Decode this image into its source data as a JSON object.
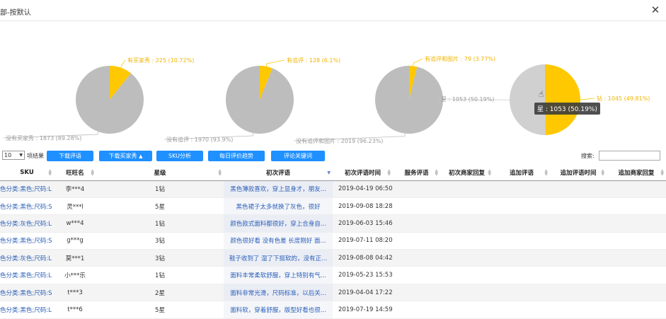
{
  "window": {
    "title": "部-按默认",
    "close_icon": "close-icon"
  },
  "chart_data": [
    {
      "type": "pie",
      "slices": [
        {
          "name": "有买家秀",
          "value": 225,
          "label": "有买家秀 : 225 (10.72%)",
          "color": "#ffc800"
        },
        {
          "name": "没有买家秀",
          "value": 1873,
          "label": "没有买家秀 : 1873 (89.28%)",
          "color": "#bdbdbd"
        }
      ]
    },
    {
      "type": "pie",
      "slices": [
        {
          "name": "有追评",
          "value": 128,
          "label": "有追评 : 128 (6.1%)",
          "color": "#ffc800"
        },
        {
          "name": "没有追评",
          "value": 1970,
          "label": "没有追评 : 1970 (93.9%)",
          "color": "#bdbdbd"
        }
      ]
    },
    {
      "type": "pie",
      "slices": [
        {
          "name": "有追评和图片",
          "value": 79,
          "label": "有追评和图片 : 79 (3.77%)",
          "color": "#ffc800"
        },
        {
          "name": "没有追评和图片",
          "value": 2019,
          "label": "没有追评和图片 : 2019 (96.23%)",
          "color": "#bdbdbd"
        }
      ]
    },
    {
      "type": "pie",
      "slices": [
        {
          "name": "钻",
          "value": 1045,
          "label": "钻 : 1045 (49.81%)",
          "color": "#ffc800"
        },
        {
          "name": "星",
          "value": 1053,
          "label": "星 : 1053 (50.19%)",
          "color": "#d0d0d0"
        }
      ]
    }
  ],
  "tooltip": "星 : 1053 (50.19%)",
  "controls": {
    "page_length": "10",
    "page_length_suffix": "项结果",
    "buttons": [
      "下载评语",
      "下载买家秀",
      "SKU分析",
      "每日评价趋势",
      "评论关键词"
    ],
    "search_label": "搜索:",
    "search_value": ""
  },
  "table": {
    "headers": [
      "SKU",
      "旺旺名",
      "星级",
      "初次评语",
      "初次评语时间",
      "服务评语",
      "初次商家回复",
      "追加评语",
      "追加评语时间",
      "追加商家回复"
    ],
    "rows": [
      [
        "色分类:黑色;尺码:L",
        "李***4",
        "1钻",
        "黑色薄款喜欢，穿上显身才，朋友...",
        "2019-04-19 06:50",
        "",
        "",
        "",
        "",
        ""
      ],
      [
        "色分类:黑色;尺码:S",
        "灵***l",
        "5星",
        "黑色裙子太多就换了灰色，很好",
        "2019-09-08 18:28",
        "",
        "",
        "",
        "",
        ""
      ],
      [
        "色分类:灰色;尺码:L",
        "w***4",
        "1钻",
        "颜色款式面料都很好，穿上合身自...",
        "2019-06-03 15:46",
        "",
        "",
        "",
        "",
        ""
      ],
      [
        "色分类:黑色;尺码:S",
        "g***g",
        "3钻",
        "颜色很好看 没有色差 长度刚好 面...",
        "2019-07-11 08:20",
        "",
        "",
        "",
        "",
        ""
      ],
      [
        "色分类:灰色;尺码:L",
        "莫***1",
        "3钻",
        "鞋子收到了 湿了下挺软的，没有正...",
        "2019-08-08 04:42",
        "",
        "",
        "",
        "",
        ""
      ],
      [
        "色分类:黑色;尺码:L",
        "小***乐",
        "1钻",
        "面料丰常柔软舒服，穿上特别有气...",
        "2019-05-23 15:53",
        "",
        "",
        "",
        "",
        ""
      ],
      [
        "色分类:黑色;尺码:S",
        "t***3",
        "2星",
        "面料非常光滑，尺码标准，以后关...",
        "2019-04-04 17:22",
        "",
        "",
        "",
        "",
        ""
      ],
      [
        "色分类:黑色;尺码:L",
        "t***6",
        "5星",
        "面料软，穿着舒服，版型好看也很...",
        "2019-07-19 14:59",
        "",
        "",
        "",
        "",
        ""
      ]
    ]
  }
}
